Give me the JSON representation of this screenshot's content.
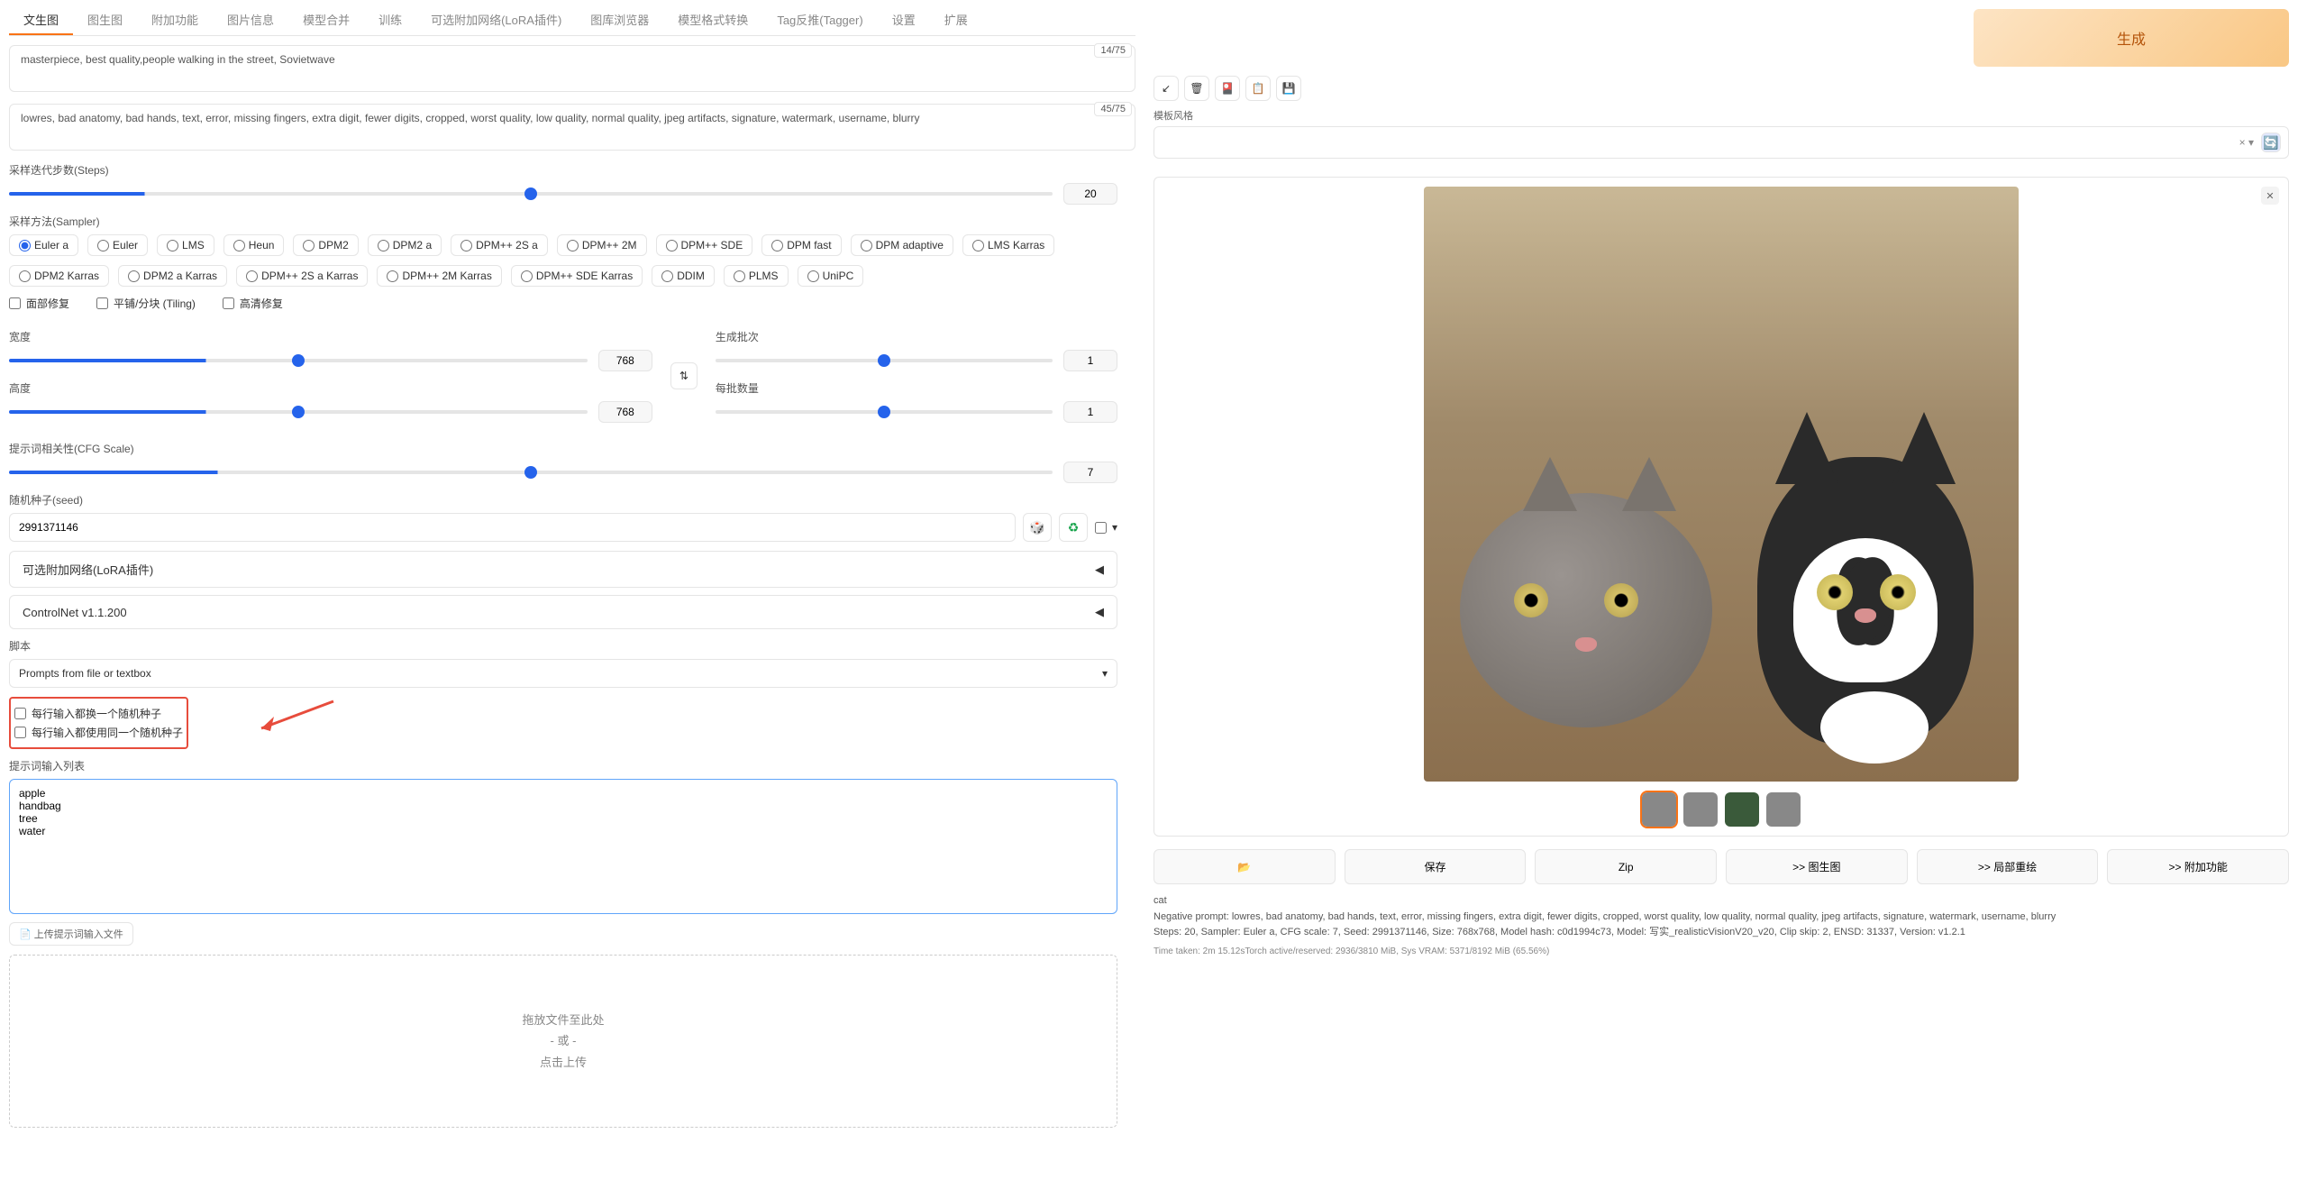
{
  "tabs": [
    "文生图",
    "图生图",
    "附加功能",
    "图片信息",
    "模型合并",
    "训练",
    "可选附加网络(LoRA插件)",
    "图库浏览器",
    "模型格式转换",
    "Tag反推(Tagger)",
    "设置",
    "扩展"
  ],
  "prompt": {
    "positive": "masterpiece, best quality,people walking in the street, Sovietwave",
    "positive_tokens": "14/75",
    "negative": "lowres, bad anatomy, bad hands, text, error, missing fingers, extra digit, fewer digits, cropped, worst quality, low quality, normal quality, jpeg artifacts, signature, watermark, username, blurry",
    "negative_tokens": "45/75"
  },
  "steps": {
    "label": "采样迭代步数(Steps)",
    "value": "20"
  },
  "sampler": {
    "label": "采样方法(Sampler)",
    "selected": "Euler a",
    "options_row1": [
      "Euler a",
      "Euler",
      "LMS",
      "Heun",
      "DPM2",
      "DPM2 a",
      "DPM++ 2S a",
      "DPM++ 2M",
      "DPM++ SDE",
      "DPM fast",
      "DPM adaptive",
      "LMS Karras"
    ],
    "options_row2": [
      "DPM2 Karras",
      "DPM2 a Karras",
      "DPM++ 2S a Karras",
      "DPM++ 2M Karras",
      "DPM++ SDE Karras",
      "DDIM",
      "PLMS",
      "UniPC"
    ]
  },
  "checks": {
    "face": "面部修复",
    "tiling": "平铺/分块 (Tiling)",
    "hires": "高清修复"
  },
  "dims": {
    "width_label": "宽度",
    "width": "768",
    "height_label": "高度",
    "height": "768",
    "batch_count_label": "生成批次",
    "batch_count": "1",
    "batch_size_label": "每批数量",
    "batch_size": "1"
  },
  "cfg": {
    "label": "提示词相关性(CFG Scale)",
    "value": "7"
  },
  "seed": {
    "label": "随机种子(seed)",
    "value": "2991371146",
    "extra_toggle": "▾"
  },
  "accordions": {
    "extra_networks": "可选附加网络(LoRA插件)",
    "controlnet": "ControlNet v1.1.200"
  },
  "script": {
    "label": "脚本",
    "value": "Prompts from file or textbox"
  },
  "script_opts": {
    "iterate_seed": "每行输入都换一个随机种子",
    "same_seed": "每行输入都使用同一个随机种子",
    "list_label": "提示词输入列表",
    "list_value": "apple\nhandbag\ntree\nwater",
    "upload": "上传提示词输入文件",
    "drop1": "拖放文件至此处",
    "drop2": "- 或 -",
    "drop3": "点击上传"
  },
  "right": {
    "generate": "生成",
    "style_label": "模板风格",
    "actions": {
      "folder": "📂",
      "save": "保存",
      "zip": "Zip",
      "img2img": ">> 图生图",
      "inpaint": ">> 局部重绘",
      "extras": ">> 附加功能"
    },
    "info_prompt": "cat",
    "info_neg": "Negative prompt: lowres, bad anatomy, bad hands, text, error, missing fingers, extra digit, fewer digits, cropped, worst quality, low quality, normal quality, jpeg artifacts, signature, watermark, username, blurry",
    "info_params": "Steps: 20, Sampler: Euler a, CFG scale: 7, Seed: 2991371146, Size: 768x768, Model hash: c0d1994c73, Model: 写实_realisticVisionV20_v20, Clip skip: 2, ENSD: 31337, Version: v1.2.1",
    "info_time": "Time taken: 2m 15.12sTorch active/reserved: 2936/3810 MiB, Sys VRAM: 5371/8192 MiB (65.56%)"
  }
}
